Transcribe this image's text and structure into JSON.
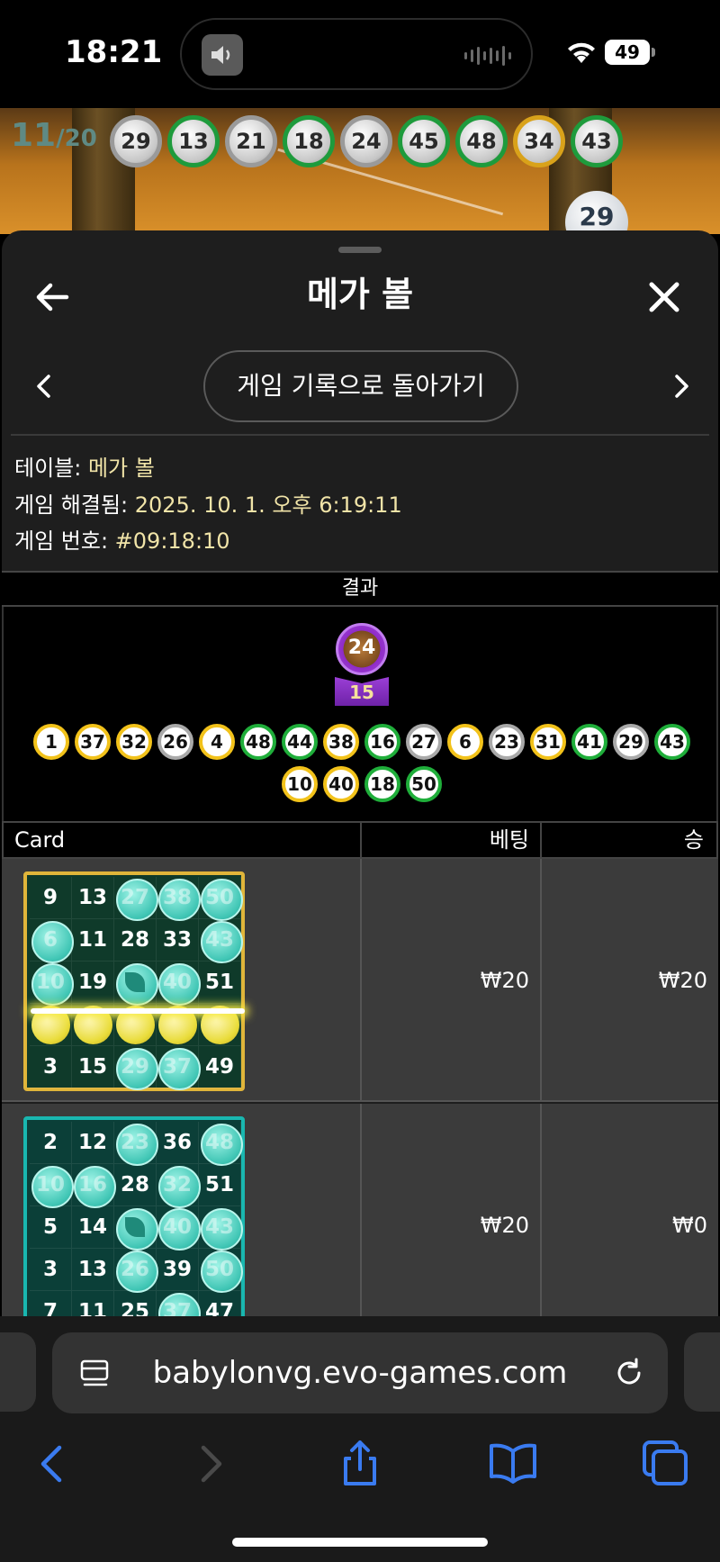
{
  "status_bar": {
    "time": "18:21",
    "battery": "49",
    "icons": [
      "speaker-icon",
      "wifi-icon",
      "battery-icon"
    ]
  },
  "game": {
    "counter_current": "11",
    "counter_total": "/20",
    "drawn_balls": [
      {
        "n": "29",
        "c": "s"
      },
      {
        "n": "13",
        "c": "g"
      },
      {
        "n": "21",
        "c": "s"
      },
      {
        "n": "18",
        "c": "g"
      },
      {
        "n": "24",
        "c": "s"
      },
      {
        "n": "45",
        "c": "g"
      },
      {
        "n": "48",
        "c": "g"
      },
      {
        "n": "34",
        "c": "y"
      },
      {
        "n": "43",
        "c": "g"
      }
    ],
    "current_ball": "29"
  },
  "sheet": {
    "title": "메가 볼",
    "history_button": "게임 기록으로 돌아가기",
    "info": {
      "table_label": "테이블: ",
      "table_value": "메가 볼",
      "resolved_label": "게임 해결됨: ",
      "resolved_value": "2025. 10. 1. 오후 6:19:11",
      "number_label": "게임 번호: ",
      "number_value": "#09:18:10"
    },
    "results_header": "결과",
    "mega_ball": "24",
    "multiplier": "15",
    "result_balls_row1": [
      {
        "n": "1",
        "c": "y"
      },
      {
        "n": "37",
        "c": "y"
      },
      {
        "n": "32",
        "c": "y"
      },
      {
        "n": "26",
        "c": "s"
      },
      {
        "n": "4",
        "c": "y"
      },
      {
        "n": "48",
        "c": "g"
      },
      {
        "n": "44",
        "c": "g"
      },
      {
        "n": "38",
        "c": "y"
      },
      {
        "n": "16",
        "c": "g"
      },
      {
        "n": "27",
        "c": "s"
      },
      {
        "n": "6",
        "c": "y"
      },
      {
        "n": "23",
        "c": "s"
      },
      {
        "n": "31",
        "c": "y"
      },
      {
        "n": "41",
        "c": "g"
      },
      {
        "n": "29",
        "c": "s"
      },
      {
        "n": "43",
        "c": "g"
      }
    ],
    "result_balls_row2": [
      {
        "n": "10",
        "c": "y"
      },
      {
        "n": "40",
        "c": "y"
      },
      {
        "n": "18",
        "c": "g"
      },
      {
        "n": "50",
        "c": "g"
      }
    ],
    "table_header": {
      "card": "Card",
      "bet": "베팅",
      "win": "승"
    },
    "rows": [
      {
        "bet": "₩20",
        "win": "₩20",
        "card_style": "gold",
        "cells": [
          [
            "9",
            "13",
            "27",
            "38",
            "50"
          ],
          [
            "6",
            "11",
            "28",
            "33",
            "43"
          ],
          [
            "10",
            "19",
            "FREE",
            "40",
            "51"
          ],
          [
            "",
            "",
            "",
            "",
            ""
          ],
          [
            "3",
            "15",
            "29",
            "37",
            "49"
          ]
        ],
        "hits": [
          [
            0,
            0,
            1,
            1,
            1
          ],
          [
            1,
            0,
            0,
            0,
            1
          ],
          [
            1,
            0,
            2,
            1,
            0
          ],
          [
            3,
            3,
            3,
            3,
            3
          ],
          [
            0,
            0,
            1,
            1,
            0
          ]
        ]
      },
      {
        "bet": "₩20",
        "win": "₩0",
        "card_style": "teal",
        "cells": [
          [
            "2",
            "12",
            "23",
            "36",
            "48"
          ],
          [
            "10",
            "16",
            "28",
            "32",
            "51"
          ],
          [
            "5",
            "14",
            "FREE",
            "40",
            "43"
          ],
          [
            "3",
            "13",
            "26",
            "39",
            "50"
          ],
          [
            "7",
            "11",
            "25",
            "37",
            "47"
          ]
        ],
        "hits": [
          [
            0,
            0,
            1,
            0,
            1
          ],
          [
            1,
            1,
            0,
            1,
            0
          ],
          [
            0,
            0,
            2,
            1,
            1
          ],
          [
            0,
            0,
            1,
            0,
            1
          ],
          [
            0,
            0,
            0,
            1,
            0
          ]
        ]
      }
    ]
  },
  "browser": {
    "url": "babylonvg.evo-games.com"
  },
  "colors": {
    "sheet_bg": "#1e1e1e",
    "info_value": "#f1e4a8",
    "ball_green": "#1fae3a",
    "ball_yellow": "#f2c21a",
    "ball_silver": "#a9a9a9",
    "mega_purple": "#8e2bc6",
    "link_blue": "#3a7bf0"
  }
}
